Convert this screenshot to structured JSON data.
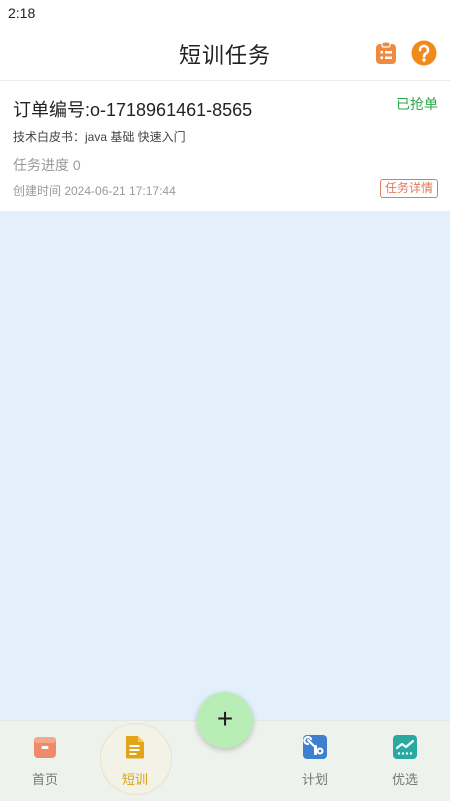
{
  "status_bar": {
    "time": "2:18"
  },
  "header": {
    "title": "短训任务"
  },
  "task_card": {
    "order_number": "订单编号:o-1718961461-8565",
    "status": "已抢单",
    "book": "技术白皮书：java 基础 快速入门",
    "progress": "任务进度 0",
    "created": "创建时间 2024-06-21 17:17:44",
    "detail_label": "任务详情"
  },
  "fab": {
    "label": "+"
  },
  "bottom_nav": {
    "items": [
      {
        "label": "首页",
        "icon": "home-icon"
      },
      {
        "label": "短训",
        "icon": "document-icon"
      },
      {
        "label": "计划",
        "icon": "tools-icon"
      },
      {
        "label": "优选",
        "icon": "chart-icon"
      }
    ]
  },
  "colors": {
    "accent_green": "#2ea84a",
    "detail_red": "#e07a5a",
    "active_nav": "#d9a21a",
    "background": "#e3f0fb",
    "fab": "#b8eeb5"
  }
}
